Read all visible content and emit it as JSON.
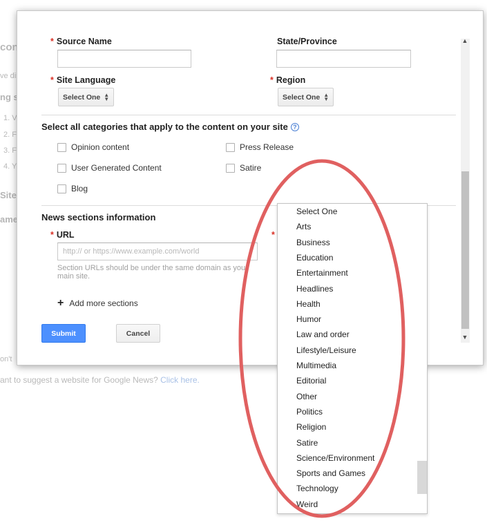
{
  "background": {
    "frag_con": "con",
    "frag_ve_dis": "ve dis",
    "frag_ng_s": "ng s",
    "list_1": "1. V",
    "list_2": "2. F",
    "list_3": "3. F",
    "list_4": "4. Y",
    "frag_sites": "Sites",
    "frag_ame": "ame",
    "frag_dont": "on't",
    "suggest_text": "ant to suggest a website for Google News?",
    "suggest_link": "Click here."
  },
  "form": {
    "required_mark": "*",
    "source_name_label": "Source Name",
    "state_province_label": "State/Province",
    "site_language_label": "Site Language",
    "region_label": "Region",
    "select_one": "Select One",
    "categories_title": "Select all categories that apply to the content on your site",
    "help_icon": "?",
    "categories": {
      "opinion": "Opinion content",
      "press_release": "Press Release",
      "user_generated": "User Generated Content",
      "satire": "Satire",
      "blog": "Blog"
    },
    "news_sections_title": "News sections information",
    "url_label": "URL",
    "url_placeholder": "http:// or https://www.example.com/world",
    "url_hint": "Section URLs should be under the same domain as your main site.",
    "add_more": "Add more sections",
    "submit": "Submit",
    "cancel": "Cancel"
  },
  "dropdown_options": [
    "Select One",
    "Arts",
    "Business",
    "Education",
    "Entertainment",
    "Headlines",
    "Health",
    "Humor",
    "Law and order",
    "Lifestyle/Leisure",
    "Multimedia",
    "Editorial",
    "Other",
    "Politics",
    "Religion",
    "Satire",
    "Science/Environment",
    "Sports and Games",
    "Technology",
    "Weird"
  ],
  "icons": {
    "select_arrows": "updown-arrows-icon",
    "plus": "plus-icon",
    "scroll_up": "scroll-up-icon",
    "scroll_down": "scroll-down-icon",
    "help": "help-icon"
  },
  "colors": {
    "primary_button": "#4d90fe",
    "annotation_ellipse": "#e06060",
    "required": "#d93025"
  }
}
